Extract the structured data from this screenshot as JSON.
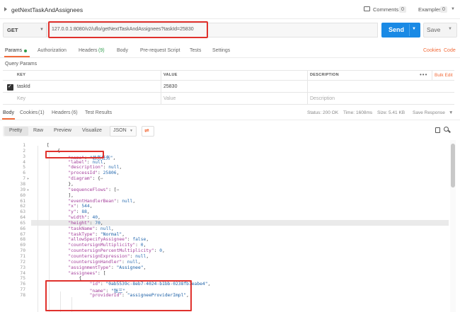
{
  "header": {
    "request_name": "getNextTaskAndAssignees",
    "comments_label": "Comments",
    "comments_count": "0",
    "examples_label": "Examples",
    "examples_count": "0"
  },
  "request": {
    "method": "GET",
    "url": "127.0.0.1:8080/v2/uflo/getNextTaskAndAssignees?taskId=25830",
    "send_label": "Send",
    "save_label": "Save"
  },
  "request_tabs": [
    {
      "label": "Params"
    },
    {
      "label": "Authorization"
    },
    {
      "label": "Headers",
      "count": "(9)"
    },
    {
      "label": "Body"
    },
    {
      "label": "Pre-request Script"
    },
    {
      "label": "Tests"
    },
    {
      "label": "Settings"
    }
  ],
  "request_links": {
    "cookies": "Cookies",
    "code": "Code"
  },
  "query_params": {
    "title": "Query Params",
    "columns": [
      "KEY",
      "VALUE",
      "DESCRIPTION"
    ],
    "more_label": "•••",
    "bulk_edit": "Bulk Edit",
    "rows": [
      {
        "key": "taskId",
        "value": "25830",
        "description": ""
      }
    ],
    "placeholders": {
      "key": "Key",
      "value": "Value",
      "description": "Description"
    }
  },
  "response_tabs": [
    {
      "label": "Body"
    },
    {
      "label": "Cookies",
      "count": "(1)"
    },
    {
      "label": "Headers",
      "count": "(6)"
    },
    {
      "label": "Test Results"
    }
  ],
  "response_status": {
    "status_label": "Status:",
    "status_value": "200 OK",
    "time_label": "Time:",
    "time_value": "1608ms",
    "size_label": "Size:",
    "size_value": "5.41 KB",
    "save_response": "Save Response"
  },
  "format_toolbar": {
    "buttons": [
      "Pretty",
      "Raw",
      "Preview",
      "Visualize"
    ],
    "format": "JSON"
  },
  "code_lines": [
    {
      "n": "1",
      "fold": "",
      "text": "["
    },
    {
      "n": "2",
      "fold": "",
      "text": "    {"
    },
    {
      "n": "3",
      "fold": "",
      "text": "        \"name\": \"总务任务\","
    },
    {
      "n": "4",
      "fold": "",
      "text": "        \"label\": null,"
    },
    {
      "n": "5",
      "fold": "",
      "text": "        \"description\": null,"
    },
    {
      "n": "6",
      "fold": "",
      "text": "        \"processId\": 25806,"
    },
    {
      "n": "7",
      "fold": "▸",
      "text": "        \"diagram\": {↔"
    },
    {
      "n": "38",
      "fold": "",
      "text": "        },"
    },
    {
      "n": "39",
      "fold": "▸",
      "text": "        \"sequenceFlows\": [↔"
    },
    {
      "n": "60",
      "fold": "",
      "text": "        ],"
    },
    {
      "n": "61",
      "fold": "",
      "text": "        \"eventHandlerBean\": null,"
    },
    {
      "n": "62",
      "fold": "",
      "text": "        \"x\": 544,"
    },
    {
      "n": "63",
      "fold": "",
      "text": "        \"y\": 88,"
    },
    {
      "n": "64",
      "fold": "",
      "text": "        \"width\": 40,"
    },
    {
      "n": "65",
      "fold": "",
      "text": "        \"height\": 70,"
    },
    {
      "n": "66",
      "fold": "",
      "text": "        \"taskName\": null,"
    },
    {
      "n": "67",
      "fold": "",
      "text": "        \"taskType\": \"Normal\","
    },
    {
      "n": "68",
      "fold": "",
      "text": "        \"allowSpecifyAssignee\": false,"
    },
    {
      "n": "69",
      "fold": "",
      "text": "        \"countersignMultiplicity\": 0,"
    },
    {
      "n": "70",
      "fold": "",
      "text": "        \"countersignPercentMultiplicity\": 0,"
    },
    {
      "n": "71",
      "fold": "",
      "text": "        \"countersignExpression\": null,"
    },
    {
      "n": "72",
      "fold": "",
      "text": "        \"countersignHandler\": null,"
    },
    {
      "n": "73",
      "fold": "",
      "text": "        \"assignmentType\": \"Assignee\","
    },
    {
      "n": "74",
      "fold": "",
      "text": "        \"assignees\": ["
    },
    {
      "n": "75",
      "fold": "",
      "text": "            {"
    },
    {
      "n": "76",
      "fold": "",
      "text": "                \"id\": \"0ab5539c-8eb7-4024-b1bb-0238fb1eabe4\","
    },
    {
      "n": "77",
      "fold": "",
      "text": "                \"name\": \"张三\","
    },
    {
      "n": "78",
      "fold": "",
      "text": "                \"providerId\": \"assigneeProviderImpl\","
    }
  ],
  "colors": {
    "accent": "#f26b3a",
    "send": "#1a8ae5",
    "status_ok": "#2e9b4b",
    "highlight": "#e0312c"
  }
}
